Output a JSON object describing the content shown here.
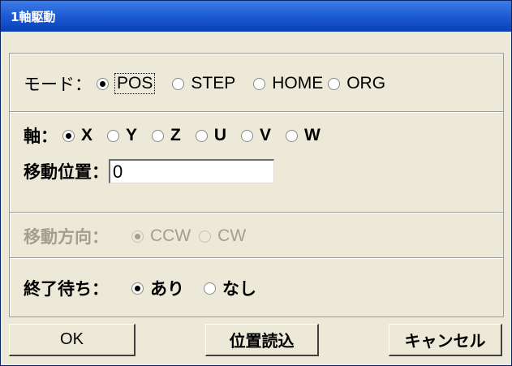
{
  "window": {
    "title": "1軸駆動"
  },
  "mode": {
    "label": "モード：",
    "options": [
      "POS",
      "STEP",
      "HOME",
      "ORG"
    ],
    "selected": "POS"
  },
  "axis": {
    "label": "軸：",
    "options": [
      "X",
      "Y",
      "Z",
      "U",
      "V",
      "W"
    ],
    "selected": "X"
  },
  "position": {
    "label": "移動位置：",
    "value": "0"
  },
  "direction": {
    "label": "移動方向：",
    "options": [
      "CCW",
      "CW"
    ],
    "selected": "CCW",
    "enabled": false
  },
  "wait": {
    "label": "終了待ち：",
    "options": [
      "あり",
      "なし"
    ],
    "selected": "あり"
  },
  "buttons": {
    "ok": "OK",
    "read_position": "位置読込",
    "cancel": "キャンセル"
  }
}
